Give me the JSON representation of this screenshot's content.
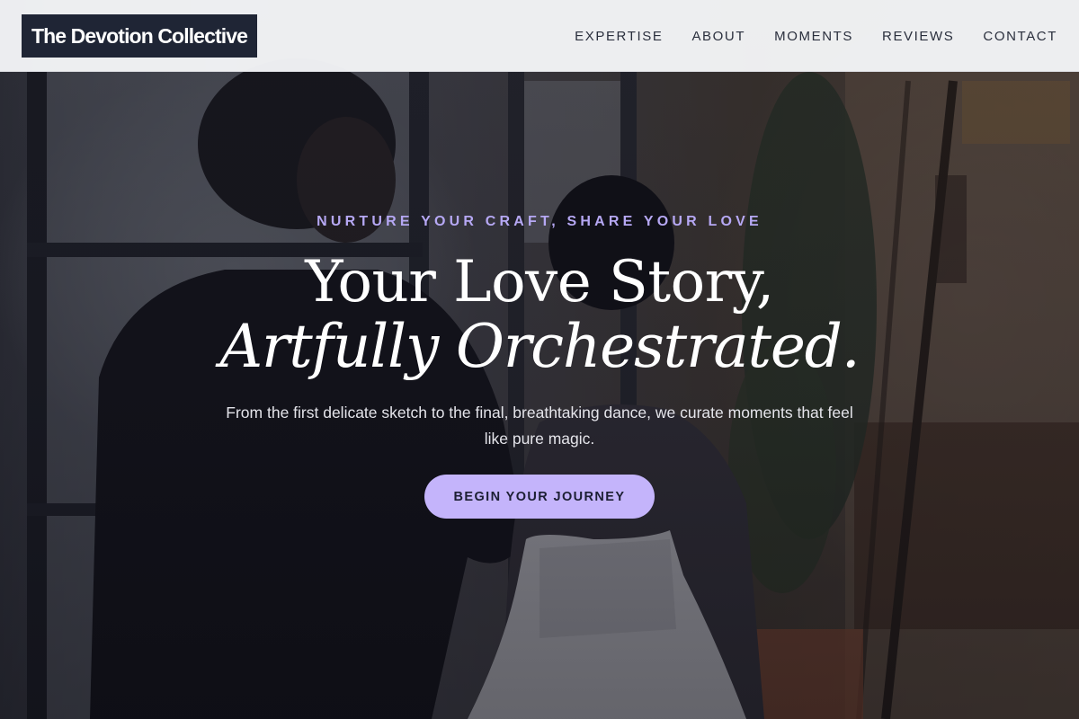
{
  "brand": {
    "name": "The Devotion Collective"
  },
  "nav": {
    "items": [
      {
        "label": "EXPERTISE"
      },
      {
        "label": "ABOUT"
      },
      {
        "label": "MOMENTS"
      },
      {
        "label": "REVIEWS"
      },
      {
        "label": "CONTACT"
      }
    ]
  },
  "hero": {
    "eyebrow": "NURTURE YOUR CRAFT, SHARE YOUR LOVE",
    "headline_line1": "Your Love Story,",
    "headline_line2": "Artfully Orchestrated.",
    "lede": "From the first delicate sketch to the final, breathtaking dance, we curate moments that feel like pure magic.",
    "cta_label": "BEGIN YOUR JOURNEY",
    "background_image": "couple-in-studio-photo"
  },
  "colors": {
    "nav_background": "#f5f6f8",
    "brand_background": "#1f2535",
    "nav_text": "#2a2f3d",
    "accent_lavender": "#c4b4fb",
    "eyebrow_text": "#b6a8f4",
    "headline_text": "#ffffff"
  }
}
